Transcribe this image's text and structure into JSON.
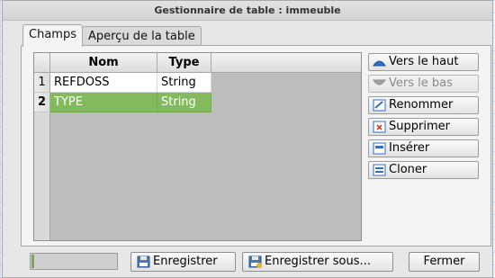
{
  "window": {
    "title": "Gestionnaire de table : immeuble"
  },
  "tabs": [
    {
      "label": "Champs",
      "active": true
    },
    {
      "label": "Aperçu de la table",
      "active": false
    }
  ],
  "table": {
    "columns": [
      "Nom",
      "Type"
    ],
    "rows": [
      {
        "num": "1",
        "name": "REFDOSS",
        "type": "String",
        "selected": false
      },
      {
        "num": "2",
        "name": "TYPE",
        "type": "String",
        "selected": true
      }
    ]
  },
  "side_buttons": {
    "up": {
      "label": "Vers le haut",
      "icon": "arrow-up-icon",
      "enabled": true
    },
    "down": {
      "label": "Vers le bas",
      "icon": "arrow-down-icon",
      "enabled": false
    },
    "rename": {
      "label": "Renommer",
      "icon": "rename-icon",
      "enabled": true
    },
    "delete": {
      "label": "Supprimer",
      "icon": "delete-icon",
      "enabled": true
    },
    "insert": {
      "label": "Insérer",
      "icon": "insert-icon",
      "enabled": true
    },
    "clone": {
      "label": "Cloner",
      "icon": "clone-icon",
      "enabled": true
    }
  },
  "bottom": {
    "save_label": "Enregistrer",
    "save_as_label": "Enregistrer sous...",
    "close_label": "Fermer",
    "progress": 0.03
  },
  "colors": {
    "selected_row": "#83ba5e",
    "accent_icon": "#2f6fc6"
  }
}
